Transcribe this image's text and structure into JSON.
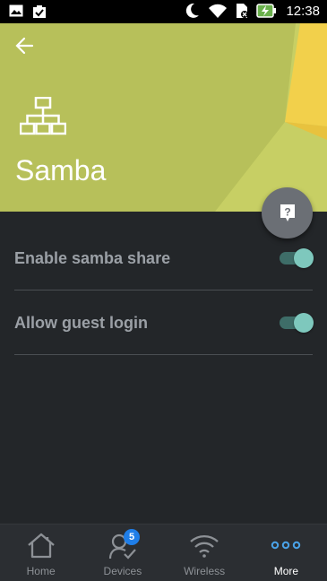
{
  "status_bar": {
    "time": "12:38",
    "left_icons": [
      "image-icon",
      "clipboard-check-icon"
    ],
    "right_icons": [
      "moon-icon",
      "wifi-icon",
      "sim-icon",
      "battery-charging-icon"
    ]
  },
  "header": {
    "title": "Samba",
    "icon": "network-share-icon",
    "background_color": "#b7c05a",
    "accent_color": "#f2d04b"
  },
  "settings": [
    {
      "label": "Enable samba share",
      "enabled": true
    },
    {
      "label": "Allow guest login",
      "enabled": true
    }
  ],
  "help_button": {
    "icon": "help-bubble-icon"
  },
  "bottom_nav": {
    "items": [
      {
        "label": "Home",
        "icon": "home-icon"
      },
      {
        "label": "Devices",
        "icon": "devices-icon",
        "badge": "5"
      },
      {
        "label": "Wireless",
        "icon": "wifi-icon"
      },
      {
        "label": "More",
        "icon": "more-icon",
        "active": true
      }
    ]
  },
  "colors": {
    "background": "#232629",
    "toggle_on": "#7ec8bd",
    "badge": "#1f7ee8",
    "more_accent": "#4aa3e8"
  }
}
